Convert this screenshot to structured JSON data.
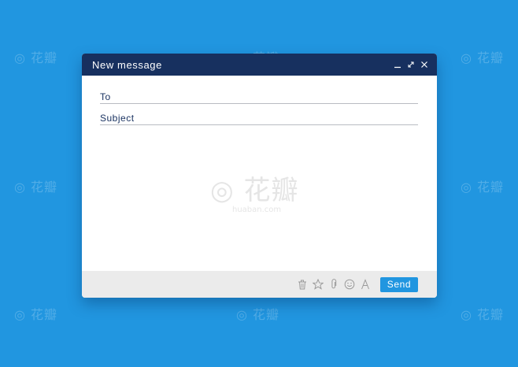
{
  "window": {
    "title": "New message",
    "controls": [
      "minimize-icon",
      "expand-icon",
      "close-icon"
    ]
  },
  "fields": {
    "to_label": "To",
    "to_value": "",
    "subject_label": "Subject",
    "subject_value": ""
  },
  "message_body": "",
  "toolbar": {
    "tools": [
      "trash-icon",
      "star-icon",
      "attachment-icon",
      "emoji-icon",
      "font-icon"
    ],
    "send_label": "Send"
  },
  "watermark": {
    "brand": "花瓣",
    "domain": "huaban.com"
  },
  "colors": {
    "background": "#2196e0",
    "titlebar": "#17305f",
    "footer": "#ebebeb",
    "send_button": "#2196e0"
  }
}
